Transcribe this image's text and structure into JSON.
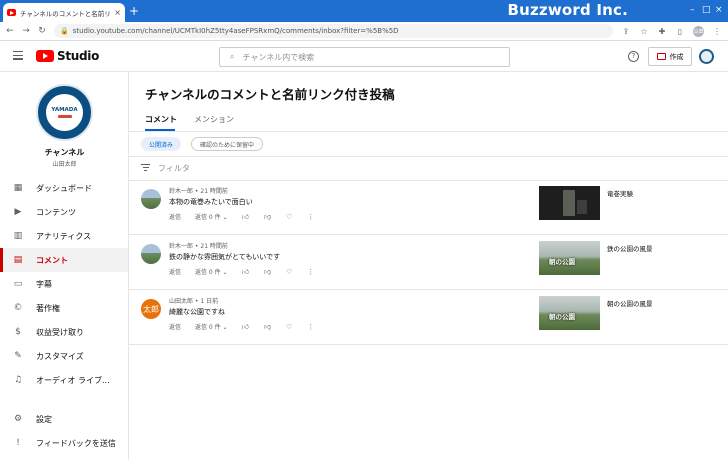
{
  "browser": {
    "tab_title": "チャンネルのコメントと名前リンク付き",
    "new_tab": "+",
    "brand_overlay": "Buzzword Inc.",
    "url": "studio.youtube.com/channel/UCMTkI0hZ5tty4aseFPSRxmQ/comments/inbox?filter=%5B%5D",
    "profile_initials": "山田"
  },
  "header": {
    "logo_text": "Studio",
    "search_placeholder": "チャンネル内で検索",
    "help": "?",
    "create_label": "作成"
  },
  "channel": {
    "avatar_text": "YAMADA",
    "name": "チャンネル",
    "owner": "山田太郎"
  },
  "sidebar": {
    "items": [
      {
        "label": "ダッシュボード",
        "icon": "dashboard-icon"
      },
      {
        "label": "コンテンツ",
        "icon": "content-icon"
      },
      {
        "label": "アナリティクス",
        "icon": "analytics-icon"
      },
      {
        "label": "コメント",
        "icon": "comments-icon"
      },
      {
        "label": "字幕",
        "icon": "subtitles-icon"
      },
      {
        "label": "著作権",
        "icon": "copyright-icon"
      },
      {
        "label": "収益受け取り",
        "icon": "monetization-icon"
      },
      {
        "label": "カスタマイズ",
        "icon": "customization-icon"
      },
      {
        "label": "オーディオ ライブ...",
        "icon": "audio-library-icon"
      }
    ],
    "bottom": [
      {
        "label": "設定",
        "icon": "settings-icon"
      },
      {
        "label": "フィードバックを送信",
        "icon": "feedback-icon"
      }
    ]
  },
  "main": {
    "title": "チャンネルのコメントと名前リンク付き投稿",
    "tabs": [
      "コメント",
      "メンション"
    ],
    "chips": [
      "公開済み",
      "確認のために保留中"
    ],
    "filter_label": "フィルタ",
    "accent": "#065fd4"
  },
  "comments": [
    {
      "author": "鈴木一郎",
      "time": "21 時間前",
      "text": "本物の竜巻みたいで面白い",
      "reply": "返信",
      "replies": "返信 0 件",
      "video_title": "竜巻実験"
    },
    {
      "author": "鈴木一郎",
      "time": "21 時間前",
      "text": "鉄の静かな雰囲気がとてもいいです",
      "reply": "返信",
      "replies": "返信 0 件",
      "video_title": "鉄の公園の風景",
      "thumb_caption": "朝の公園"
    },
    {
      "author": "山田太郎",
      "time": "1 日前",
      "avatar_text": "太郎",
      "text": "綺麗な公園ですね",
      "reply": "返信",
      "replies": "返信 0 件",
      "video_title": "朝の公園の風景",
      "thumb_caption": "朝の公園"
    }
  ]
}
